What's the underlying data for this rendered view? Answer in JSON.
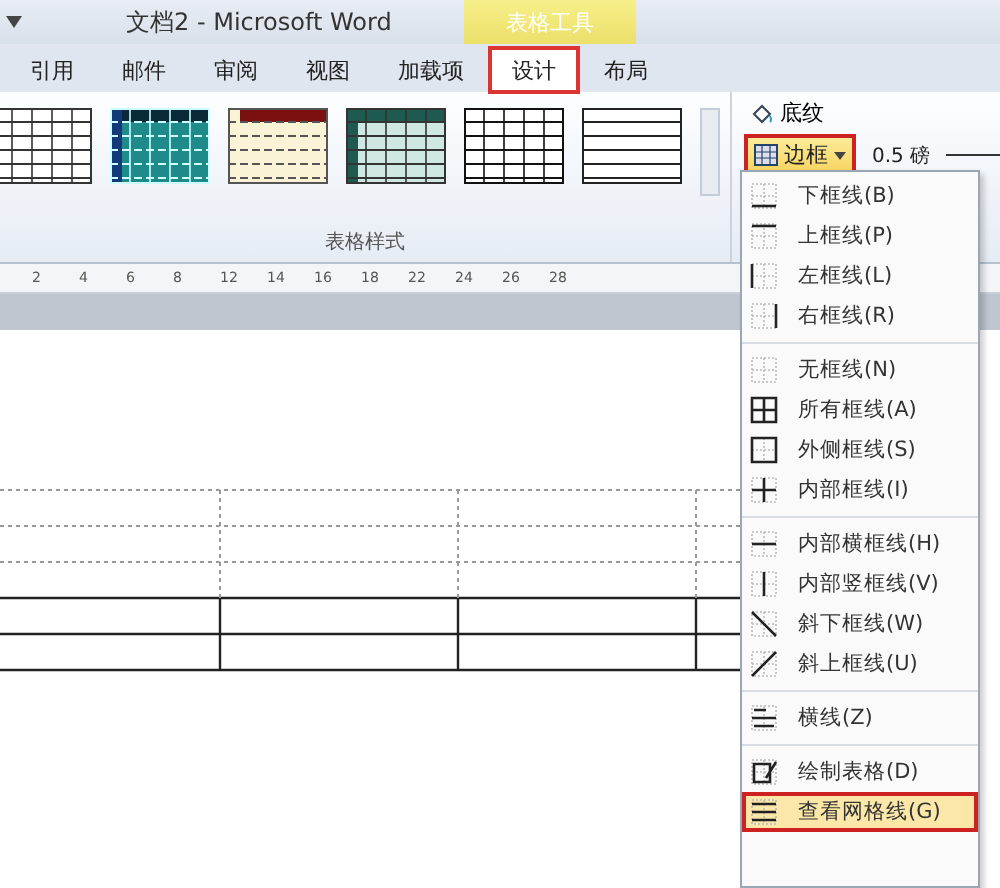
{
  "window": {
    "title": "文档2 - Microsoft Word"
  },
  "contextual_tab_group": {
    "label": "表格工具"
  },
  "tabs": [
    {
      "label": "引用",
      "selected": false,
      "highlighted": false
    },
    {
      "label": "邮件",
      "selected": false,
      "highlighted": false
    },
    {
      "label": "审阅",
      "selected": false,
      "highlighted": false
    },
    {
      "label": "视图",
      "selected": false,
      "highlighted": false
    },
    {
      "label": "加载项",
      "selected": false,
      "highlighted": false
    },
    {
      "label": "设计",
      "selected": true,
      "highlighted": true
    },
    {
      "label": "布局",
      "selected": false,
      "highlighted": false
    }
  ],
  "ribbon": {
    "group_label": "表格样式",
    "shading_button": "底纹",
    "borders_button": {
      "label": "边框",
      "highlighted": true
    },
    "line_weight": "0.5 磅"
  },
  "ruler": {
    "ticks": [
      "2",
      "4",
      "6",
      "8",
      "12",
      "14",
      "16",
      "18",
      "22",
      "24",
      "26",
      "28"
    ]
  },
  "borders_menu": [
    {
      "label": "下框线(B)",
      "highlighted": false,
      "separator_before": false
    },
    {
      "label": "上框线(P)",
      "highlighted": false,
      "separator_before": false
    },
    {
      "label": "左框线(L)",
      "highlighted": false,
      "separator_before": false
    },
    {
      "label": "右框线(R)",
      "highlighted": false,
      "separator_before": false
    },
    {
      "label": "无框线(N)",
      "highlighted": false,
      "separator_before": true
    },
    {
      "label": "所有框线(A)",
      "highlighted": false,
      "separator_before": false
    },
    {
      "label": "外侧框线(S)",
      "highlighted": false,
      "separator_before": false
    },
    {
      "label": "内部框线(I)",
      "highlighted": false,
      "separator_before": false
    },
    {
      "label": "内部横框线(H)",
      "highlighted": false,
      "separator_before": true
    },
    {
      "label": "内部竖框线(V)",
      "highlighted": false,
      "separator_before": false
    },
    {
      "label": "斜下框线(W)",
      "highlighted": false,
      "separator_before": false
    },
    {
      "label": "斜上框线(U)",
      "highlighted": false,
      "separator_before": false
    },
    {
      "label": "横线(Z)",
      "highlighted": false,
      "separator_before": true
    },
    {
      "label": "绘制表格(D)",
      "highlighted": false,
      "separator_before": true
    },
    {
      "label": "查看网格线(G)",
      "highlighted": true,
      "separator_before": false
    }
  ]
}
